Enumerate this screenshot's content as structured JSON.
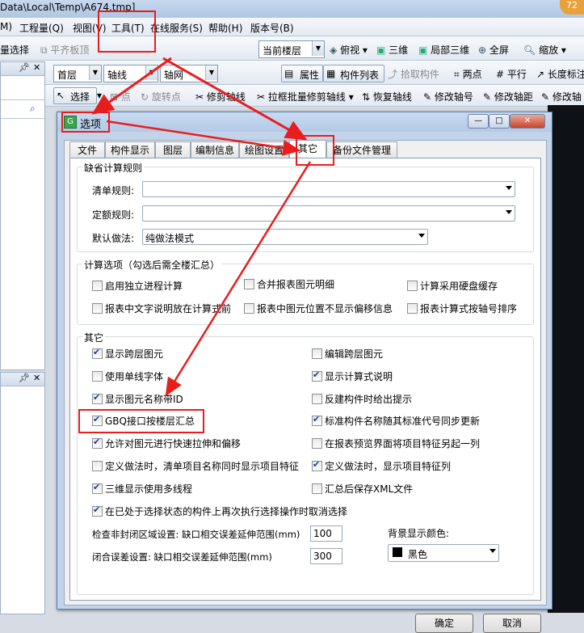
{
  "titlebar": {
    "path": "Data\\Local\\Temp\\A674.tmp]",
    "badge": "72"
  },
  "menubar": {
    "items": [
      "M)",
      "工程量(Q)",
      "视图(V)",
      "工具(T)",
      "在线服务(S)",
      "帮助(H)",
      "版本号(B)"
    ]
  },
  "toolbar1": {
    "batch_select": "量选择",
    "align_slab": "平齐板顶",
    "current_floor": "当前楼层",
    "top_view": "俯视",
    "view_3d": "三维",
    "local_3d": "局部三维",
    "fullscreen": "全屏",
    "zoom": "缩放"
  },
  "toolbar2": {
    "floor": "首层",
    "axis": "轴线",
    "axis_grid": "轴网",
    "properties": "属性",
    "component_list": "构件列表",
    "pick_component": "拾取构件",
    "two_points": "两点",
    "parallel": "平行",
    "length_dim": "长度标注"
  },
  "toolbar3": {
    "select": "选择",
    "point": "点",
    "rotate_point": "旋转点",
    "trim_axis": "修剪轴线",
    "box_trim": "拉框批量修剪轴线",
    "restore_axis": "恢复轴线",
    "modify_axis_no": "修改轴号",
    "modify_axis_dist": "修改轴距",
    "modify_label": "修改轴"
  },
  "dialog": {
    "title": "选项",
    "tabs": [
      "文件",
      "构件显示",
      "图层",
      "编制信息",
      "绘图设置",
      "其它",
      "备份文件管理"
    ],
    "active_tab": "其它",
    "default_rules": {
      "label": "缺省计算规则",
      "bill_rule_label": "清单规则:",
      "bill_rule_value": "",
      "quota_rule_label": "定额规则:",
      "quota_rule_value": "",
      "default_method_label": "默认做法:",
      "default_method_value": "纯做法模式"
    },
    "calc_options": {
      "label": "计算选项（勾选后需全楼汇总）",
      "items": [
        {
          "label": "启用独立进程计算",
          "checked": false
        },
        {
          "label": "合并报表图元明细",
          "checked": false
        },
        {
          "label": "计算采用硬盘缓存",
          "checked": false
        },
        {
          "label": "报表中文字说明放在计算式前",
          "checked": false
        },
        {
          "label": "报表中图元位置不显示偏移信息",
          "checked": false
        },
        {
          "label": "报表计算式按轴号排序",
          "checked": false
        }
      ]
    },
    "other": {
      "label": "其它",
      "left": [
        {
          "label": "显示跨层图元",
          "checked": true
        },
        {
          "label": "使用单线字体",
          "checked": false
        },
        {
          "label": "显示图元名称带ID",
          "checked": true
        },
        {
          "label": "GBQ接口按楼层汇总",
          "checked": true
        },
        {
          "label": "允许对图元进行快速拉伸和偏移",
          "checked": true
        },
        {
          "label": "定义做法时，清单项目名称同时显示项目特征",
          "checked": false
        },
        {
          "label": "三维显示使用多线程",
          "checked": true
        },
        {
          "label": "在已处于选择状态的构件上再次执行选择操作时取消选择",
          "checked": true
        }
      ],
      "right": [
        {
          "label": "编辑跨层图元",
          "checked": false
        },
        {
          "label": "显示计算式说明",
          "checked": true
        },
        {
          "label": "反建构件时给出提示",
          "checked": false
        },
        {
          "label": "标准构件名称随其标准代号同步更新",
          "checked": true
        },
        {
          "label": "在报表预览界面将项目特征另起一列",
          "checked": false
        },
        {
          "label": "定义做法时，显示项目特征列",
          "checked": true
        },
        {
          "label": "汇总后保存XML文件",
          "checked": false
        }
      ],
      "open_region_label": "检查非封闭区域设置: 缺口相交误差延伸范围(mm)",
      "open_region_value": "100",
      "closure_label": "闭合误差设置: 缺口相交误差延伸范围(mm)",
      "closure_value": "300",
      "bg_color_label": "背景显示颜色:",
      "bg_color_value": "黑色",
      "bg_color_hex": "#000000"
    },
    "ok": "确定",
    "cancel": "取消"
  },
  "colors": {
    "highlight_red": "#e81e1e"
  }
}
